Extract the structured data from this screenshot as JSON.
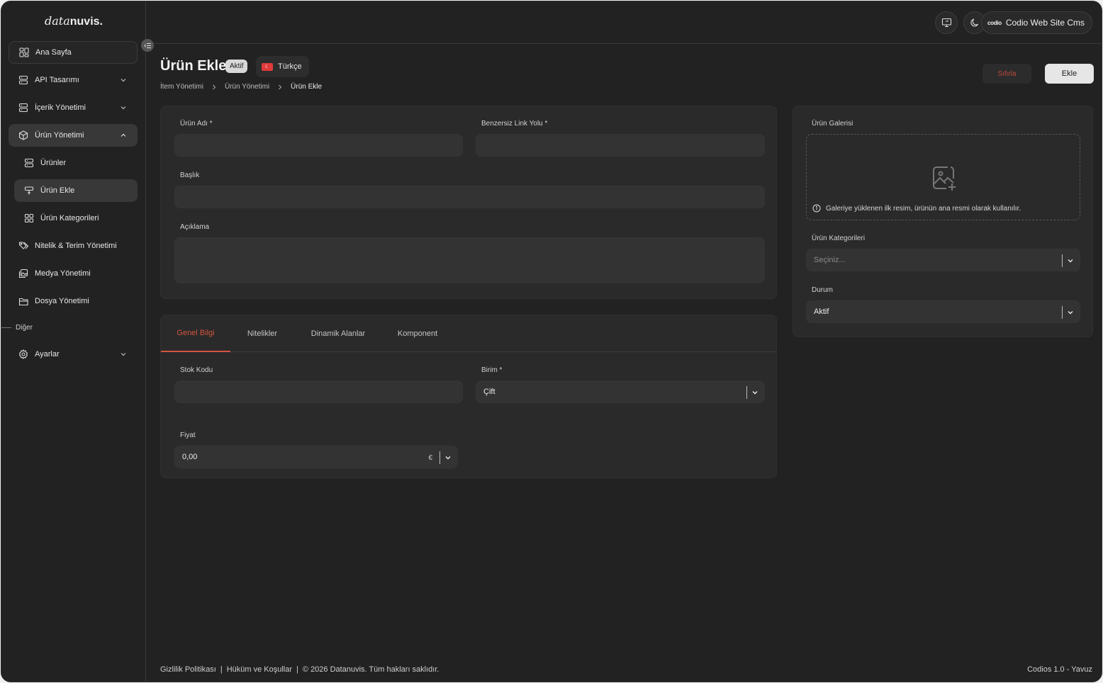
{
  "app": {
    "logo_light": "data",
    "logo_bold": "nuvis."
  },
  "header": {
    "monitor_icon": "monitor-icon",
    "theme_icon": "moon-icon",
    "workspace_logo": "codio",
    "workspace_label": "Codio Web Site Cms"
  },
  "sidebar": {
    "items": [
      {
        "label": "Ana Sayfa",
        "icon": "dashboard-grid-icon"
      },
      {
        "label": "API Tasarımı",
        "icon": "database-icon"
      },
      {
        "label": "İçerik Yönetimi",
        "icon": "database-icon"
      },
      {
        "label": "Ürün Yönetimi",
        "icon": "box-icon"
      },
      {
        "label": "Ürünler",
        "icon": "database-icon"
      },
      {
        "label": "Ürün Ekle",
        "icon": "tag-add-icon"
      },
      {
        "label": "Ürün Kategorileri",
        "icon": "grid-icon"
      },
      {
        "label": "Nitelik & Terim Yönetimi",
        "icon": "tags-icon"
      },
      {
        "label": "Medya Yönetimi",
        "icon": "images-icon"
      },
      {
        "label": "Dosya Yönetimi",
        "icon": "folder-icon"
      }
    ],
    "section_other": "Diğer",
    "settings_label": "Ayarlar"
  },
  "page": {
    "title": "Ürün Ekle",
    "status_badge": "Aktif",
    "language": "Türkçe",
    "flag_glyph": "☾",
    "breadcrumb": [
      "İtem Yönetimi",
      "Ürün Yönetimi",
      "Ürün Ekle"
    ],
    "reset_label": "Sıfırla",
    "add_label": "Ekle"
  },
  "form": {
    "product_name_label": "Ürün Adı *",
    "product_name_value": "",
    "slug_label": "Benzersiz Link Yolu *",
    "slug_value": "",
    "title_label": "Başlık",
    "title_value": "",
    "description_label": "Açıklama",
    "description_value": ""
  },
  "tabs": [
    {
      "label": "Genel Bilgi",
      "active": true
    },
    {
      "label": "Nitelikler",
      "active": false
    },
    {
      "label": "Dinamik Alanlar",
      "active": false
    },
    {
      "label": "Komponent",
      "active": false
    }
  ],
  "general": {
    "stock_code_label": "Stok Kodu",
    "stock_code_value": "",
    "unit_label": "Birim *",
    "unit_value": "Çift",
    "price_label": "Fiyat",
    "price_value": "0,00",
    "currency_symbol": "€"
  },
  "right": {
    "gallery_label": "Ürün Galerisi",
    "gallery_note": "Galeriye yüklenen ilk resim, ürünün ana resmi olarak kullanılır.",
    "categories_label": "Ürün Kategorileri",
    "categories_placeholder": "Seçiniz...",
    "status_label": "Durum",
    "status_value": "Aktif"
  },
  "footer": {
    "privacy": "Gizlilik Politikası",
    "terms": "Hüküm ve Koşullar",
    "copyright": "© 2026 Datanuvis. Tüm hakları saklıdır.",
    "version": "Codios 1.0 - Yavuz"
  },
  "colors": {
    "background": "#222222",
    "card": "#2a2a2a",
    "input": "#333333",
    "accent": "#d4543e",
    "reset_text": "#c24a3c"
  }
}
